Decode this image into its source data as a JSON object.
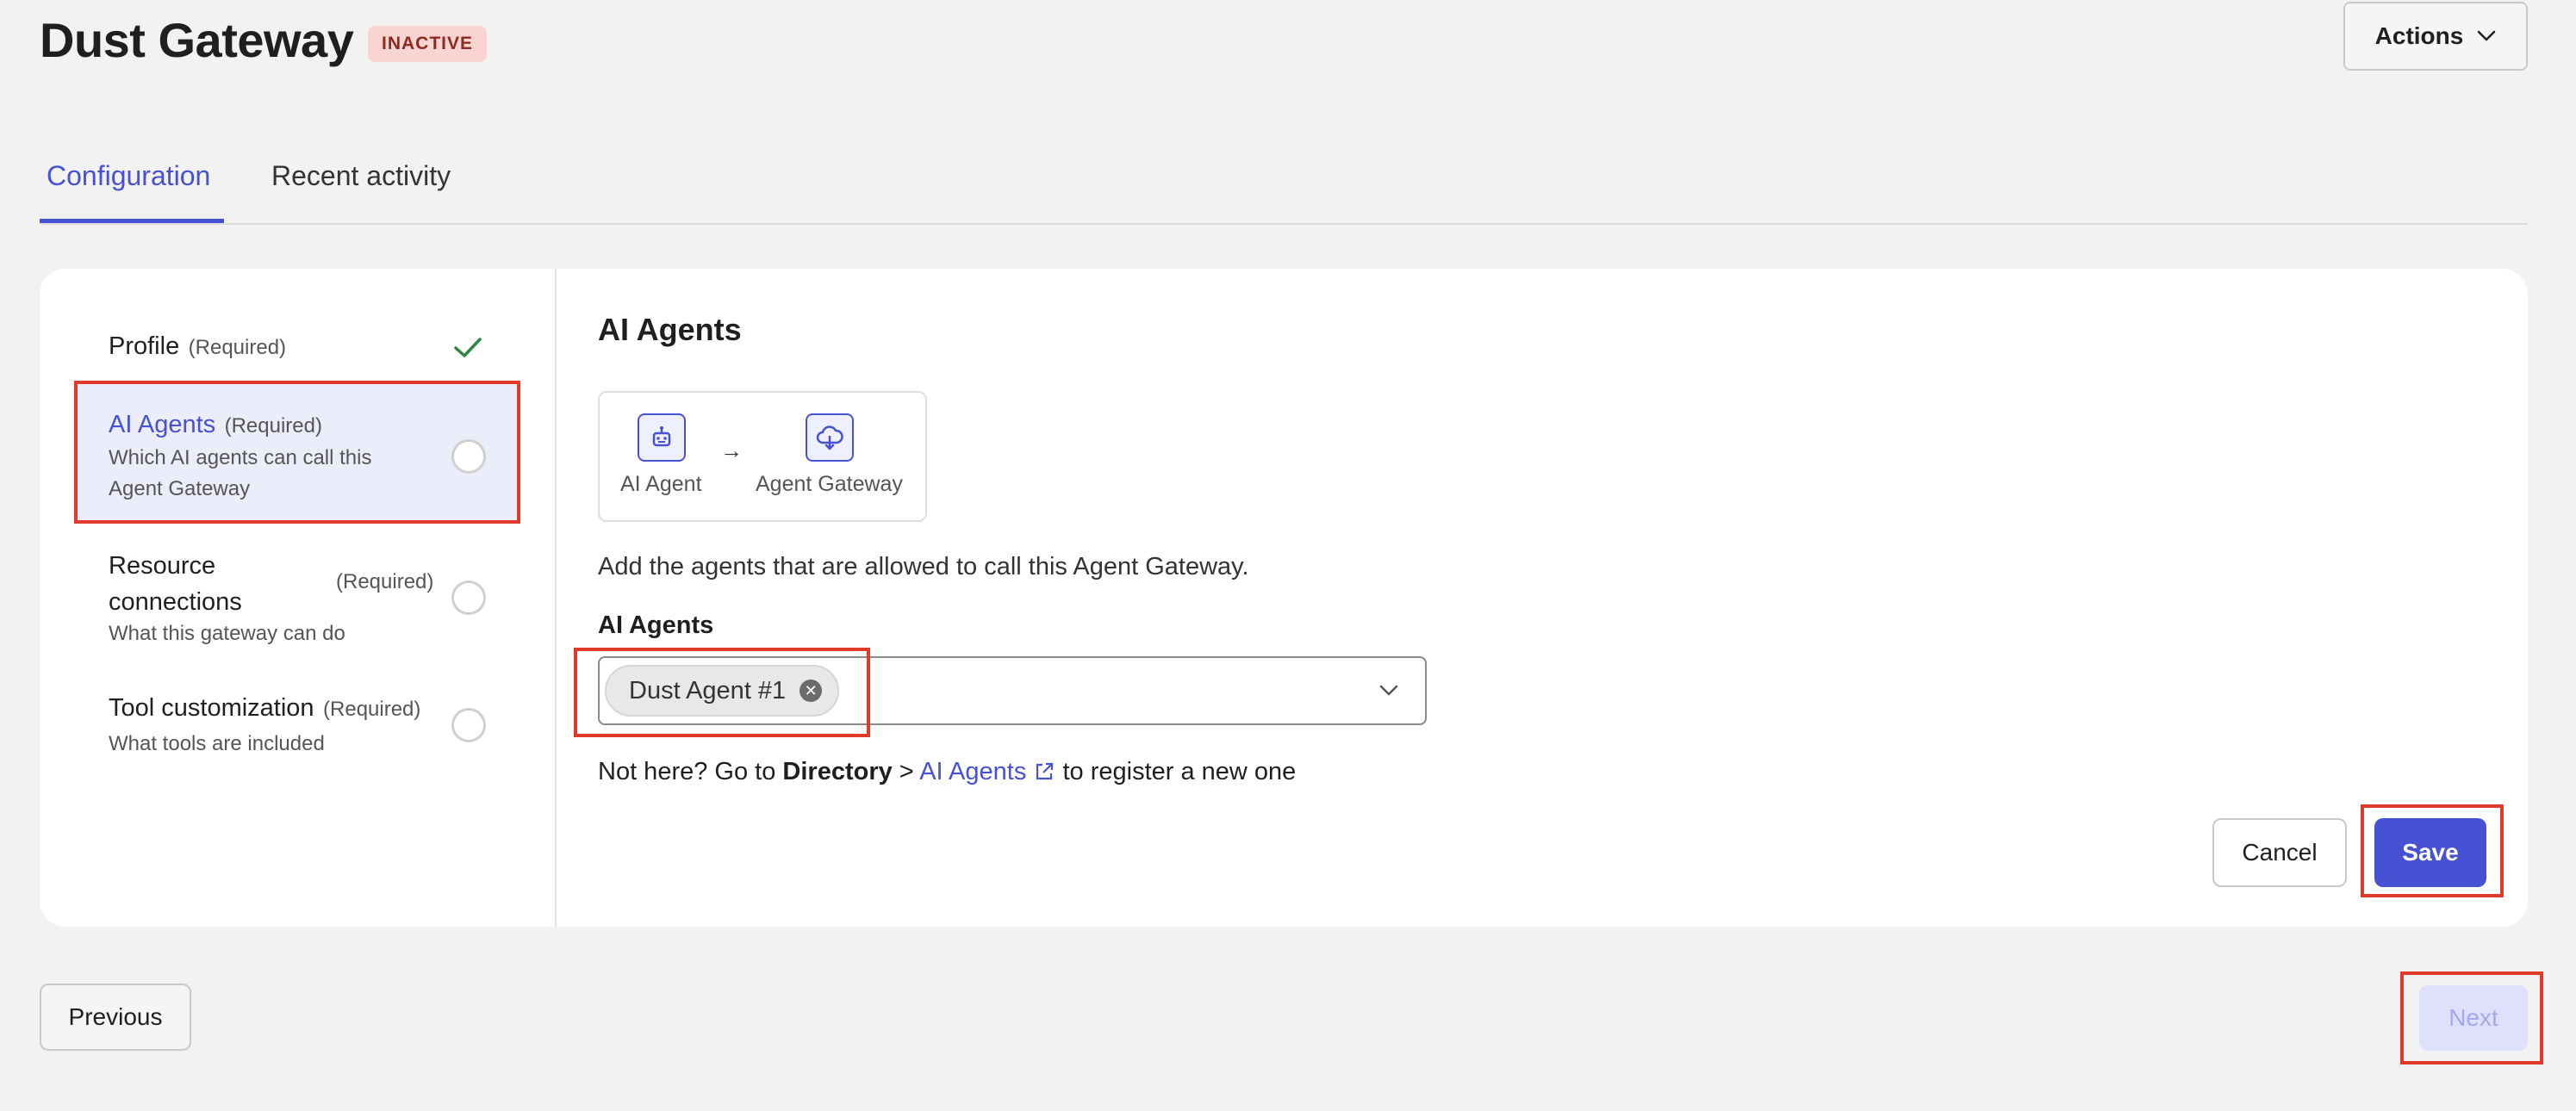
{
  "header": {
    "title": "Dust Gateway",
    "status": "INACTIVE",
    "actions_label": "Actions"
  },
  "tabs": [
    {
      "label": "Configuration",
      "active": true
    },
    {
      "label": "Recent activity",
      "active": false
    }
  ],
  "steps": [
    {
      "title": "Profile",
      "required": "(Required)",
      "description": "",
      "state": "complete"
    },
    {
      "title": "AI Agents",
      "required": "(Required)",
      "description": "Which AI agents can call this Agent Gateway",
      "state": "active"
    },
    {
      "title": "Resource connections",
      "required": "(Required)",
      "description": "What this gateway can do",
      "state": "incomplete"
    },
    {
      "title": "Tool customization",
      "required": "(Required)",
      "description": "What tools are included",
      "state": "incomplete"
    }
  ],
  "panel": {
    "title": "AI Agents",
    "flow": {
      "from_label": "AI Agent",
      "arrow": "→",
      "to_label": "Agent Gateway"
    },
    "instruction": "Add the agents that are allowed to call this Agent Gateway.",
    "field_label": "AI Agents",
    "selected_chip": "Dust Agent #1",
    "help": {
      "prefix": "Not here? Go to",
      "bold": "Directory",
      "separator": ">",
      "link": "AI Agents",
      "suffix": "to register a new one"
    },
    "cancel_label": "Cancel",
    "save_label": "Save"
  },
  "footer": {
    "previous_label": "Previous",
    "next_label": "Next"
  },
  "colors": {
    "accent": "#4651d4",
    "badge_bg": "#fad4d0",
    "badge_text": "#8f2a20",
    "check": "#2e8540",
    "highlight": "#e03a2c"
  }
}
